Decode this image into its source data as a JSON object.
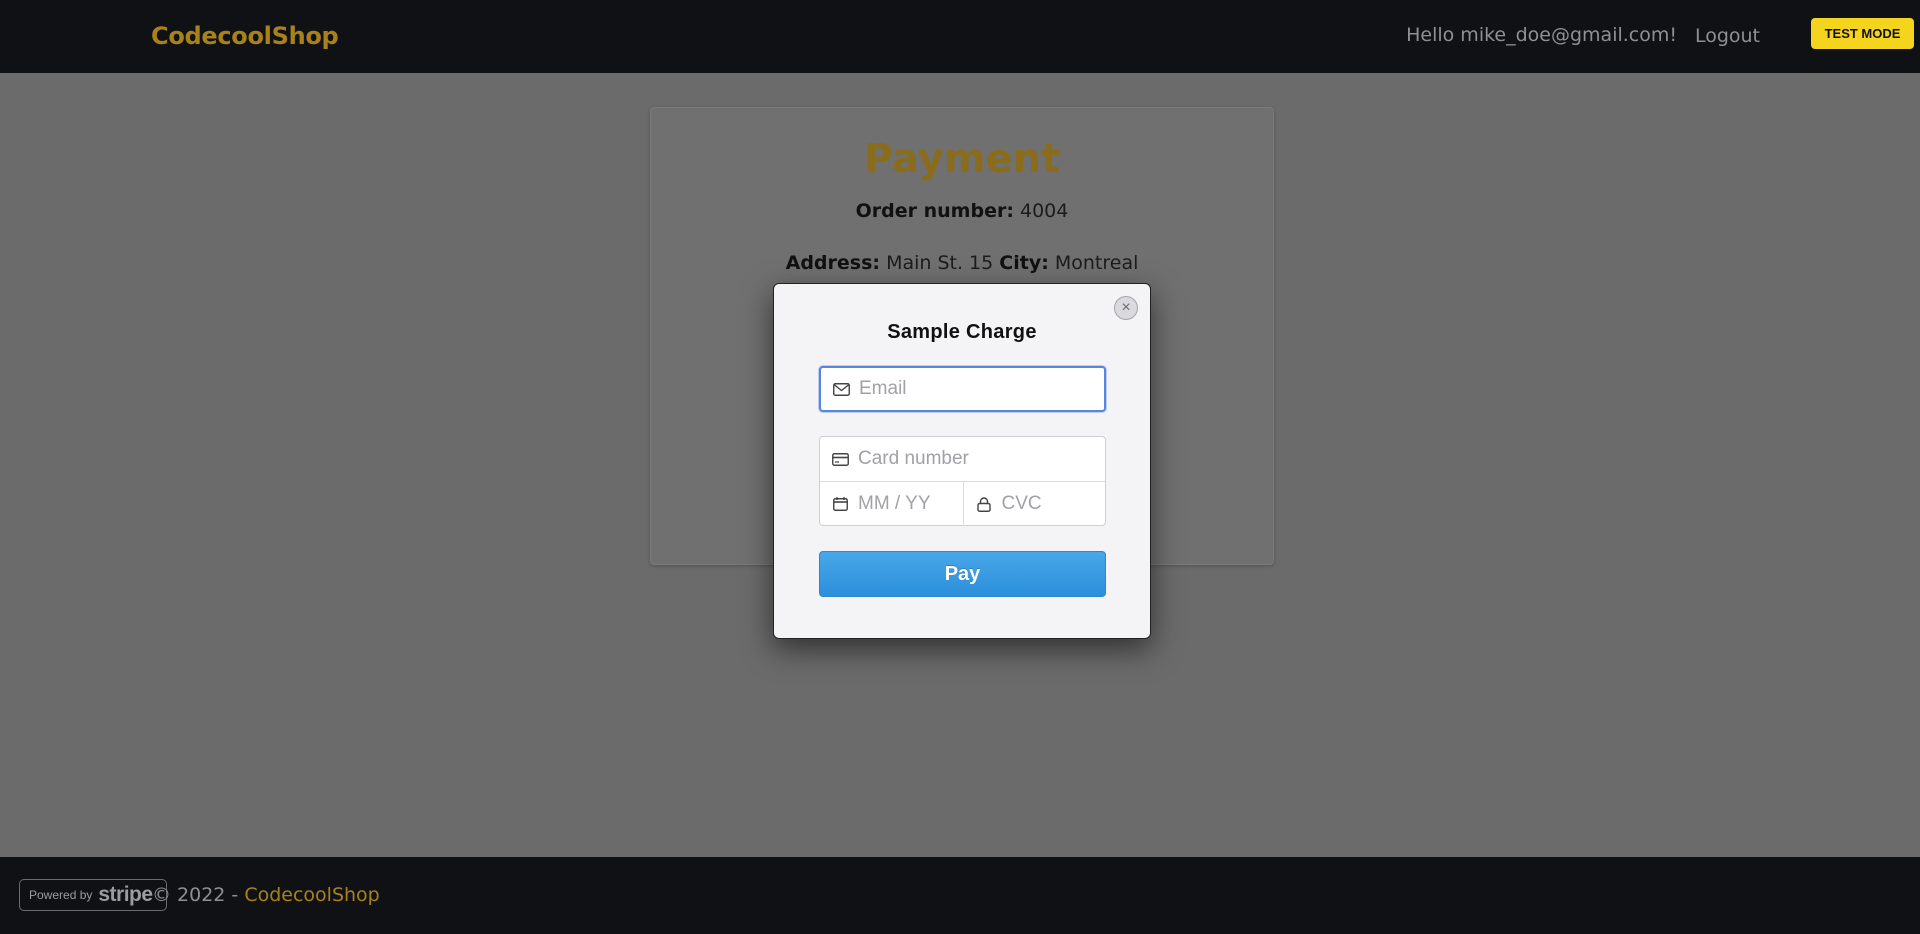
{
  "navbar": {
    "brand": "CodecoolShop",
    "greeting": "Hello mike_doe@gmail.com!",
    "logout_label": "Logout",
    "test_mode_badge": "TEST MODE"
  },
  "payment": {
    "title": "Payment",
    "order_number_label": "Order number:",
    "order_number_value": "4004",
    "address_label": "Address:",
    "address_value": "Main St. 15",
    "city_label": "City:",
    "city_value": "Montreal"
  },
  "modal": {
    "title": "Sample Charge",
    "close_label": "×",
    "email_placeholder": "Email",
    "card_number_placeholder": "Card number",
    "expiry_placeholder": "MM / YY",
    "cvc_placeholder": "CVC",
    "pay_label": "Pay"
  },
  "footer": {
    "powered_by": "Powered by",
    "stripe": "stripe",
    "copyright_prefix": "© 2022 - ",
    "copyright_brand": "CodecoolShop"
  },
  "colors": {
    "brand_accent": "#a8811a",
    "pay_button": "#2c8fdb",
    "test_mode": "#f5d41e"
  },
  "icons": [
    "envelope-icon",
    "credit-card-icon",
    "calendar-icon",
    "lock-icon",
    "close-icon"
  ]
}
